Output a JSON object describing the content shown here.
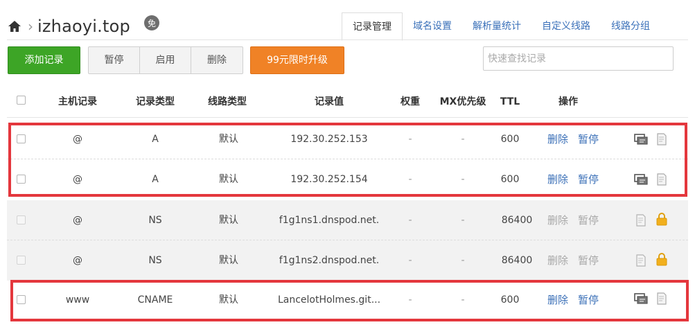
{
  "header": {
    "domain": "izhaoyi.top",
    "badge_text": "免",
    "tabs": [
      "记录管理",
      "域名设置",
      "解析量统计",
      "自定义线路",
      "线路分组"
    ]
  },
  "toolbar": {
    "add_label": "添加记录",
    "pause_label": "暂停",
    "enable_label": "启用",
    "delete_label": "删除",
    "upgrade_label": "99元限时升级",
    "search_placeholder": "快速查找记录"
  },
  "table": {
    "columns": [
      "主机记录",
      "记录类型",
      "线路类型",
      "记录值",
      "权重",
      "MX优先级",
      "TTL",
      "操作"
    ],
    "rows": [
      {
        "host": "@",
        "type": "A",
        "line": "默认",
        "value": "192.30.252.153",
        "weight": "-",
        "mx": "-",
        "ttl": "600",
        "delete": "删除",
        "pause": "暂停",
        "locked": false
      },
      {
        "host": "@",
        "type": "A",
        "line": "默认",
        "value": "192.30.252.154",
        "weight": "-",
        "mx": "-",
        "ttl": "600",
        "delete": "删除",
        "pause": "暂停",
        "locked": false
      },
      {
        "host": "@",
        "type": "NS",
        "line": "默认",
        "value": "f1g1ns1.dnspod.net.",
        "weight": "-",
        "mx": "-",
        "ttl": "86400",
        "delete": "删除",
        "pause": "暂停",
        "locked": true
      },
      {
        "host": "@",
        "type": "NS",
        "line": "默认",
        "value": "f1g1ns2.dnspod.net.",
        "weight": "-",
        "mx": "-",
        "ttl": "86400",
        "delete": "删除",
        "pause": "暂停",
        "locked": true
      },
      {
        "host": "www",
        "type": "CNAME",
        "line": "默认",
        "value": "LancelotHolmes.git...",
        "weight": "-",
        "mx": "-",
        "ttl": "600",
        "delete": "删除",
        "pause": "暂停",
        "locked": false
      }
    ]
  },
  "colors": {
    "add_button": "#3da526",
    "upgrade_button": "#f08226",
    "link": "#3a6fb7",
    "highlight": "#e4373d",
    "lock": "#f2b01e"
  }
}
